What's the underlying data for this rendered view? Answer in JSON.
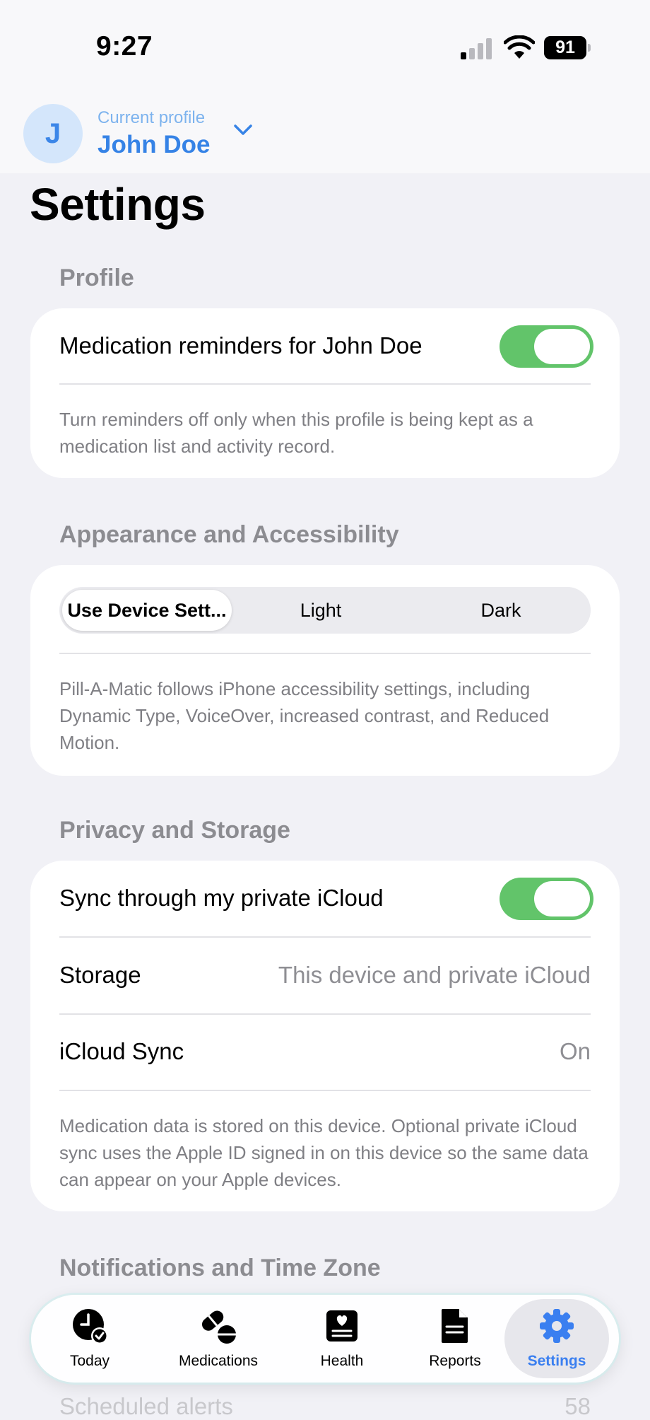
{
  "status_bar": {
    "time": "9:27",
    "battery": "91"
  },
  "profile": {
    "avatar_initial": "J",
    "caption": "Current profile",
    "name": "John Doe"
  },
  "page_title": "Settings",
  "sections": {
    "profile": {
      "header": "Profile",
      "reminders_label": "Medication reminders for John Doe",
      "reminders_on": true,
      "footnote": "Turn reminders off only when this profile is being kept as a medication list and activity record."
    },
    "appearance": {
      "header": "Appearance and Accessibility",
      "options": [
        "Use Device Sett...",
        "Light",
        "Dark"
      ],
      "selected": "Use Device Sett...",
      "footnote": "Pill-A-Matic follows iPhone accessibility settings, including Dynamic Type, VoiceOver, increased contrast, and Reduced Motion."
    },
    "privacy": {
      "header": "Privacy and Storage",
      "sync_label": "Sync through my private iCloud",
      "sync_on": true,
      "storage_label": "Storage",
      "storage_value": "This device and private iCloud",
      "icloud_label": "iCloud Sync",
      "icloud_value": "On",
      "footnote": "Medication data is stored on this device. Optional private iCloud sync uses the Apple ID signed in on this device so the same data can appear on your Apple devices."
    },
    "notifications": {
      "header": "Notifications and Time Zone",
      "partial_row_label": "Scheduled alerts",
      "partial_row_value": "58"
    }
  },
  "tab_bar": {
    "tabs": [
      {
        "label": "Today",
        "icon": "clock-check-icon"
      },
      {
        "label": "Medications",
        "icon": "pills-icon"
      },
      {
        "label": "Health",
        "icon": "health-record-icon"
      },
      {
        "label": "Reports",
        "icon": "document-icon"
      },
      {
        "label": "Settings",
        "icon": "gear-icon"
      }
    ],
    "active": "Settings"
  },
  "colors": {
    "accent": "#3683e6",
    "toggle_on": "#62c46a",
    "background": "#f1f1f6"
  }
}
